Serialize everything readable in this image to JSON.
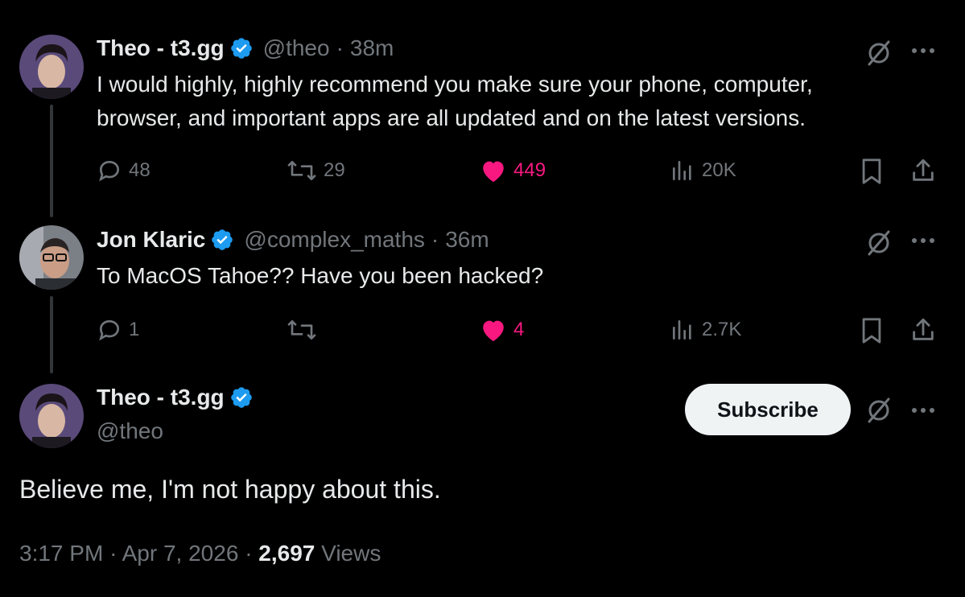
{
  "tweet1": {
    "name": "Theo - t3.gg",
    "handle": "@theo",
    "time": "38m",
    "text_line1": "I would highly, highly recommend you make sure your phone, computer,",
    "text_line2": "browser, and important apps are all updated and on the latest versions.",
    "replies": "48",
    "reposts": "29",
    "likes": "449",
    "views": "20K"
  },
  "tweet2": {
    "name": "Jon Klaric",
    "handle": "@complex_maths",
    "time": "36m",
    "text": "To MacOS Tahoe?? Have you been hacked?",
    "replies": "1",
    "reposts": "",
    "likes": "4",
    "views": "2.7K"
  },
  "main_tweet": {
    "name": "Theo - t3.gg",
    "handle": "@theo",
    "subscribe_label": "Subscribe",
    "text": "Believe me, I'm not happy about this.",
    "time": "3:17 PM",
    "date": "Apr 7, 2026",
    "views_count": "2,697",
    "views_label": "Views"
  },
  "separator": "·",
  "colors": {
    "background": "#000000",
    "text": "#e7e9ea",
    "muted": "#71767b",
    "like": "#f91880",
    "verified": "#1d9bf0"
  },
  "icons": [
    "verified-badge-icon",
    "grok-icon",
    "more-icon",
    "reply-icon",
    "repost-icon",
    "heart-icon",
    "views-icon",
    "bookmark-icon",
    "share-icon"
  ]
}
